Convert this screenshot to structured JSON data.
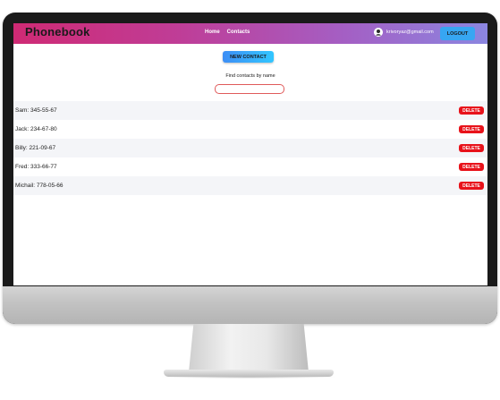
{
  "header": {
    "logo": "Phonebook",
    "nav": {
      "home": "Home",
      "contacts": "Contacts"
    },
    "user_email": "krivoryaz@gmail.com",
    "logout_label": "LOGOUT"
  },
  "actions": {
    "new_contact_label": "NEW CONTACT",
    "find_label": "Find contacts by name",
    "search_value": ""
  },
  "contacts": [
    {
      "text": "Sam: 345-55-67",
      "delete_label": "DELETE"
    },
    {
      "text": "Jack: 234-67-80",
      "delete_label": "DELETE"
    },
    {
      "text": "Billy: 221-09-67",
      "delete_label": "DELETE"
    },
    {
      "text": "Fred: 333-66-77",
      "delete_label": "DELETE"
    },
    {
      "text": "Michail: 778-05-66",
      "delete_label": "DELETE"
    }
  ],
  "colors": {
    "header_gradient_start": "#cf2a74",
    "header_gradient_end": "#8b86e0",
    "logout_button": "#37a6f2",
    "new_contact_gradient_start": "#3d8ef5",
    "new_contact_gradient_end": "#32c6ff",
    "delete_button": "#e8121a",
    "search_border": "#e05a5a"
  },
  "icons": {
    "avatar": "user-avatar-icon"
  }
}
